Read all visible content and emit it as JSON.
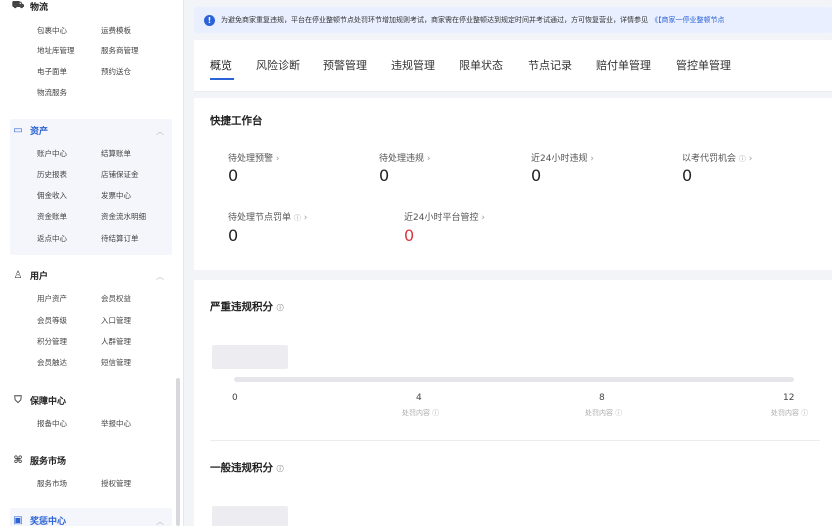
{
  "sidebar": {
    "logistics": {
      "title": "物流",
      "items": [
        "包裹中心",
        "运费模板",
        "地址库管理",
        "服务商管理",
        "电子面单",
        "预约送仓",
        "物流服务"
      ]
    },
    "assets": {
      "title": "资产",
      "items": [
        "账户中心",
        "结算账单",
        "历史报表",
        "店铺保证金",
        "佣金收入",
        "发票中心",
        "资金账单",
        "资金流水明细",
        "返点中心",
        "待结算订单"
      ]
    },
    "users": {
      "title": "用户",
      "items": [
        "用户资产",
        "会员权益",
        "会员等级",
        "入口管理",
        "积分管理",
        "人群管理",
        "会员触达",
        "短信管理"
      ]
    },
    "guarantee": {
      "title": "保障中心",
      "items": [
        "报备中心",
        "举报中心"
      ]
    },
    "market": {
      "title": "服务市场",
      "items": [
        "服务市场",
        "授权管理"
      ]
    },
    "rewards": {
      "title": "奖惩中心"
    }
  },
  "notice": {
    "text": "为避免商家重复违规，平台在停业整顿节点处罚环节增加规则考试，商家需在停业整顿达到规定时间并考试通过，方可恢复营业，详情参见",
    "link": "《【商家一停业整顿节点"
  },
  "tabs": [
    "概览",
    "风险诊断",
    "预警管理",
    "违规管理",
    "限单状态",
    "节点记录",
    "赔付单管理",
    "管控单管理"
  ],
  "shortcuts": {
    "title": "快捷工作台",
    "metrics": [
      {
        "label": "待处理预警",
        "value": "0"
      },
      {
        "label": "待处理违规",
        "value": "0"
      },
      {
        "label": "近24小时违规",
        "value": "0"
      },
      {
        "label": "以考代罚机会",
        "value": "0"
      },
      {
        "label": "待处理节点罚单",
        "value": "0"
      },
      {
        "label": "近24小时平台管控",
        "value": "0"
      }
    ]
  },
  "serious": {
    "title": "严重违规积分",
    "ticks": [
      "0",
      "4",
      "8",
      "12"
    ],
    "tick_sub": "处罚内容"
  },
  "general": {
    "title": "一般违规积分"
  },
  "icons": {
    "logistics": "truck-icon",
    "assets": "wallet-icon",
    "users": "user-icon",
    "guarantee": "shield-icon",
    "market": "grid-icon",
    "rewards": "badge-icon",
    "notice": "info-icon",
    "help": "help-circle-icon",
    "arrow": "chevron-right-icon"
  },
  "colors": {
    "accent": "#2c63d6",
    "danger": "#d9363e",
    "notice_bg": "#e9efff"
  }
}
